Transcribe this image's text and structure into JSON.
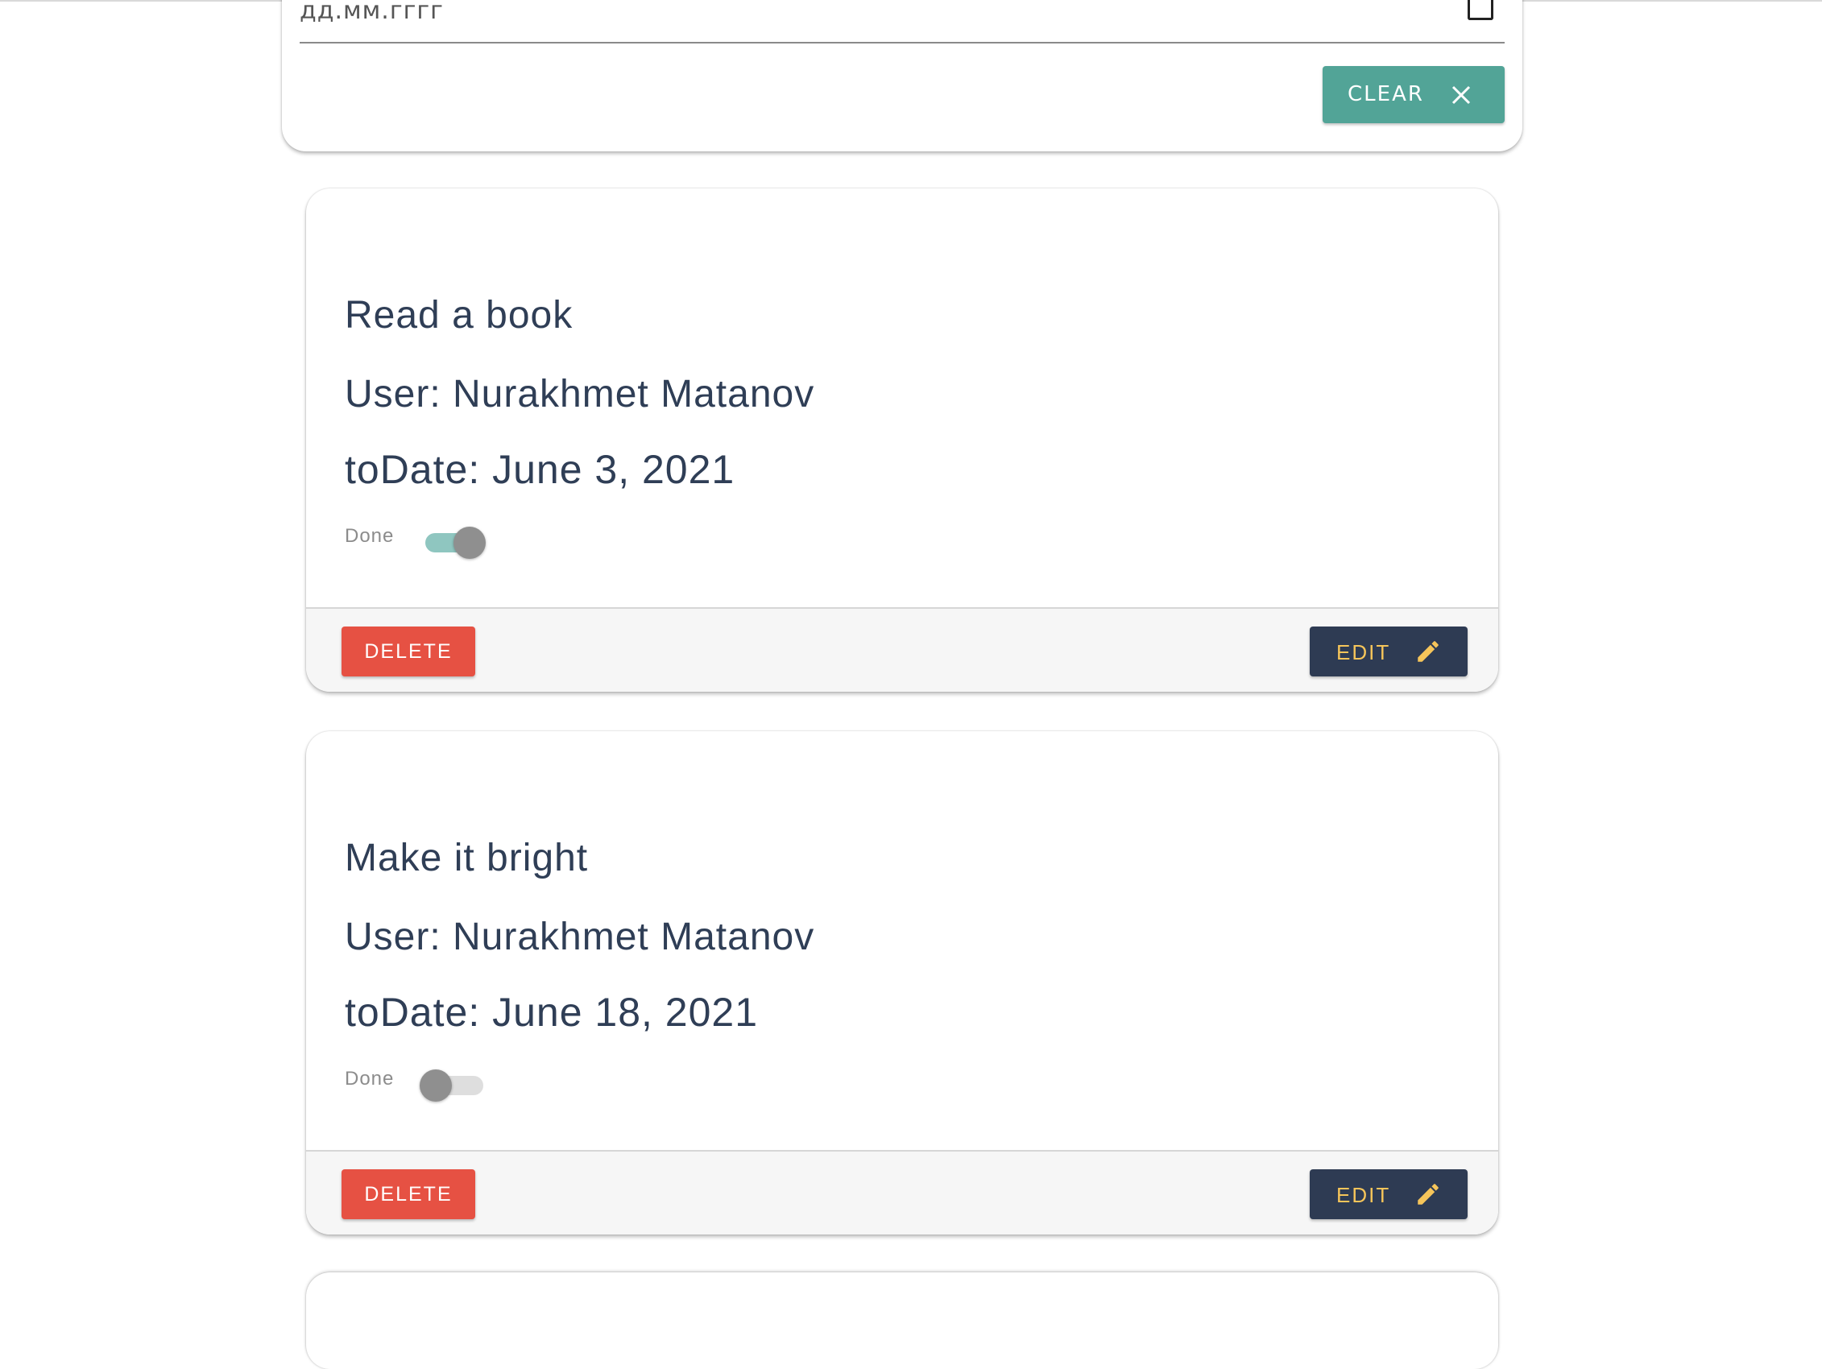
{
  "filter": {
    "date_placeholder": "дд.мм.гггг",
    "calendar_icon": "calendar-icon",
    "clear_label": "CLEAR",
    "clear_icon": "close-icon",
    "clear_color": "#52a497"
  },
  "todos": [
    {
      "title": "Read a book",
      "user": "User: Nurakhmet Matanov",
      "to_date": "toDate: June 3, 2021",
      "done_label": "Done",
      "done": true,
      "delete_label": "DELETE",
      "edit_label": "EDIT"
    },
    {
      "title": "Make it bright",
      "user": "User: Nurakhmet Matanov",
      "to_date": "toDate: June 18, 2021",
      "done_label": "Done",
      "done": false,
      "delete_label": "DELETE",
      "edit_label": "EDIT"
    }
  ],
  "colors": {
    "text": "#2f3e56",
    "delete": "#e65143",
    "edit_bg": "#2e3b53",
    "edit_text": "#f6c55a",
    "switch_on_track": "#8fc6c0"
  }
}
